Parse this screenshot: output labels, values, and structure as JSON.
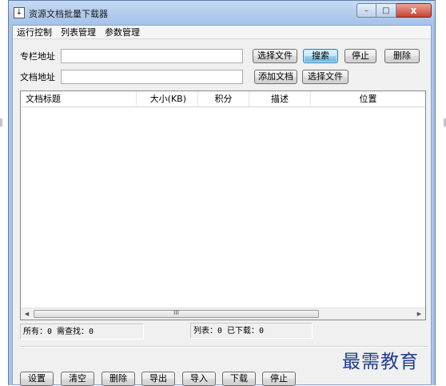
{
  "window": {
    "title": "资源文档批量下载器",
    "close_glyph": "x",
    "minimize_glyph": "–",
    "maximize_glyph": "□"
  },
  "menu": [
    "运行控制",
    "列表管理",
    "参数管理"
  ],
  "form": {
    "column_url_label": "专栏地址",
    "column_url_value": "",
    "doc_url_label": "文档地址",
    "doc_url_value": "",
    "choose_file_1": "选择文件",
    "search": "搜索",
    "stop_top": "停止",
    "delete_top": "删除",
    "add_doc": "添加文档",
    "choose_file_2": "选择文件"
  },
  "table": {
    "columns": [
      "文档标题",
      "大小(KB)",
      "积分",
      "描述",
      "位置"
    ],
    "rows": []
  },
  "scrollbar": {
    "left_arrow": "◀",
    "right_arrow": "▶",
    "grip": "III"
  },
  "status": {
    "left": "所有：0 需查找：0",
    "right": "列表：0 已下载：0"
  },
  "bottom_buttons": [
    "设置",
    "清空",
    "删除",
    "导出",
    "导入",
    "下载",
    "停止"
  ],
  "watermark": "最需教育"
}
